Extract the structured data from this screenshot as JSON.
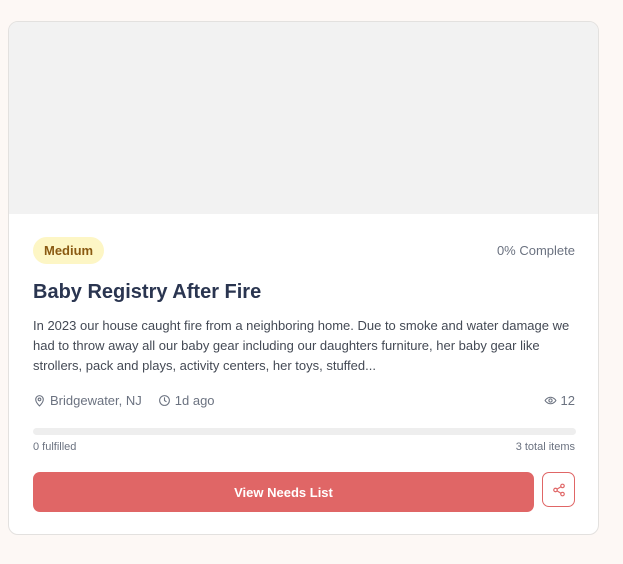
{
  "card": {
    "priority_badge": "Medium",
    "completion_text": "0% Complete",
    "title": "Baby Registry After Fire",
    "description": "In 2023 our house caught fire from a neighboring home. Due to smoke and water damage we had to throw away all our baby gear including our daughters furniture, her baby gear like strollers, pack and plays, activity centers, her toys, stuffed...",
    "location": "Bridgewater, NJ",
    "posted_time": "1d ago",
    "views": "12",
    "progress_fraction": 0,
    "fulfilled_text": "0 fulfilled",
    "total_items_text": "3 total items",
    "view_button_label": "View Needs List"
  },
  "icons": {
    "location": "map-pin-icon",
    "time": "clock-icon",
    "views": "eye-icon",
    "share": "share-icon"
  },
  "colors": {
    "accent": "#e06666",
    "badge_bg": "#fdf6c5",
    "badge_text": "#8a5a12",
    "title": "#2a3550"
  }
}
